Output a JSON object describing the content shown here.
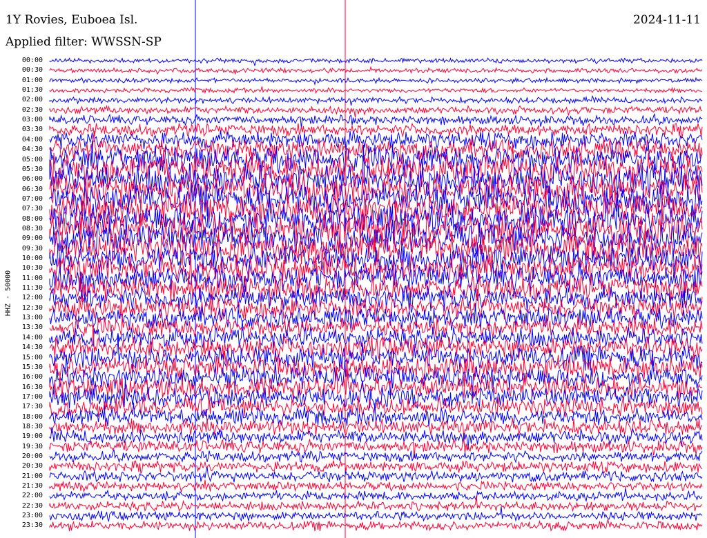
{
  "header": {
    "station": "1Y Rovies, Euboea Isl.",
    "filter": "Applied filter: WWSSN-SP",
    "date": "2024-11-11"
  },
  "channel_label": "HHZ - 50000",
  "colors": {
    "blue": "#0000ff",
    "red": "#ff0033",
    "background": "#ffffff"
  },
  "chart_data": {
    "type": "line",
    "title": "1Y Rovies, Euboea Isl.",
    "subtitle": "Applied filter: WWSSN-SP",
    "date": "2024-11-11",
    "ylabel": "HHZ - 50000",
    "row_labels": [
      "00:00",
      "00:30",
      "01:00",
      "01:30",
      "02:00",
      "02:30",
      "03:00",
      "03:30",
      "04:00",
      "04:30",
      "05:00",
      "05:30",
      "06:00",
      "06:30",
      "07:00",
      "07:30",
      "08:00",
      "08:30",
      "09:00",
      "09:30",
      "10:00",
      "10:30",
      "11:00",
      "11:30",
      "12:00",
      "12:30",
      "13:00",
      "13:30",
      "14:00",
      "14:30",
      "15:00",
      "15:30",
      "16:00",
      "16:30",
      "17:00",
      "17:30",
      "18:00",
      "18:30",
      "19:00",
      "19:30",
      "20:00",
      "20:30",
      "21:00",
      "21:30",
      "22:00",
      "22:30",
      "23:00",
      "23:30"
    ],
    "row_colors": [
      "blue",
      "red"
    ],
    "relative_amplitude": [
      0.15,
      0.15,
      0.15,
      0.15,
      0.2,
      0.25,
      0.3,
      0.4,
      0.55,
      0.7,
      0.9,
      1.0,
      1.0,
      1.0,
      1.0,
      1.0,
      1.0,
      1.0,
      1.0,
      1.0,
      0.95,
      0.9,
      0.85,
      0.8,
      0.75,
      0.7,
      0.7,
      0.65,
      0.65,
      0.7,
      0.75,
      0.75,
      0.75,
      0.7,
      0.65,
      0.6,
      0.55,
      0.5,
      0.45,
      0.4,
      0.35,
      0.35,
      0.35,
      0.3,
      0.3,
      0.3,
      0.3,
      0.3
    ],
    "grid": false
  }
}
